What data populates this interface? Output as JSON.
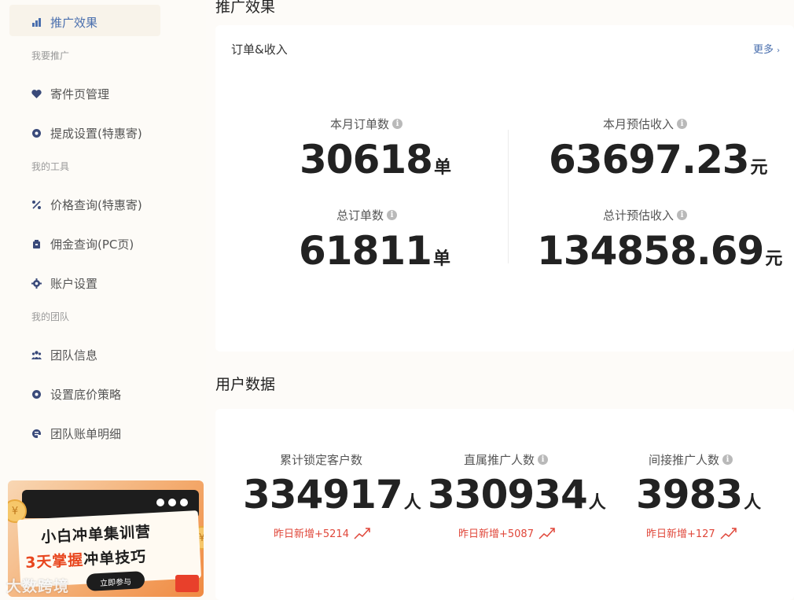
{
  "sidebar": {
    "items": [
      {
        "label": "推广效果",
        "icon": "bar-chart-icon"
      },
      {
        "label": "寄件页管理",
        "icon": "tag-heart-icon"
      },
      {
        "label": "提成设置(特惠寄)",
        "icon": "coin-icon"
      },
      {
        "label": "价格查询(特惠寄)",
        "icon": "percent-icon"
      },
      {
        "label": "佣金查询(PC页)",
        "icon": "wallet-icon"
      },
      {
        "label": "账户设置",
        "icon": "gear-icon"
      },
      {
        "label": "团队信息",
        "icon": "team-icon"
      },
      {
        "label": "设置底价策略",
        "icon": "coin-icon"
      },
      {
        "label": "团队账单明细",
        "icon": "bill-icon"
      }
    ],
    "groups": [
      "我要推广",
      "我的工具",
      "我的团队"
    ]
  },
  "banner": {
    "title": "小白冲单集训营",
    "subtitle_prefix": "3天掌握",
    "subtitle_suffix": "冲单技巧",
    "cta": "立即参与",
    "coin": "¥"
  },
  "watermark": "大数跨境",
  "main": {
    "section1_title": "推广效果",
    "card_title": "订单&收入",
    "more": "更多",
    "stats": [
      {
        "label": "本月订单数",
        "value": "30618",
        "unit": "单"
      },
      {
        "label": "本月预估收入",
        "value": "63697.23",
        "unit": "元"
      },
      {
        "label": "总订单数",
        "value": "61811",
        "unit": "单"
      },
      {
        "label": "总计预估收入",
        "value": "134858.69",
        "unit": "元"
      }
    ],
    "section2_title": "用户数据",
    "users": [
      {
        "label": "累计锁定客户数",
        "value": "334917",
        "unit": "人",
        "delta": "昨日新增+5214"
      },
      {
        "label": "直属推广人数",
        "value": "330934",
        "unit": "人",
        "delta": "昨日新增+5087"
      },
      {
        "label": "间接推广人数",
        "value": "3983",
        "unit": "人",
        "delta": "昨日新增+127"
      }
    ]
  },
  "colors": {
    "accent": "#4a6fae",
    "delta_red": "#e0473a",
    "sidebar_bg": "#fdfbf7"
  }
}
